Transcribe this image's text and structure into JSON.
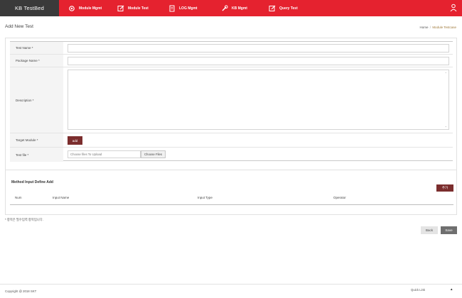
{
  "app": {
    "brand": "KB TestBed",
    "nav": [
      {
        "label": "Module Mgmt",
        "icon": "gear-icon"
      },
      {
        "label": "Module Test",
        "icon": "edit-icon"
      },
      {
        "label": "LOG Mgmt",
        "icon": "document-icon"
      },
      {
        "label": "KB Mgmt",
        "icon": "wrench-icon"
      },
      {
        "label": "Query Test",
        "icon": "edit-icon"
      }
    ],
    "user_icon": "user-icon"
  },
  "page": {
    "title": "Add New Test",
    "breadcrumb": {
      "home": "Home",
      "separator": "/",
      "current": "Module Testcase"
    }
  },
  "form": {
    "test_name": {
      "label": "Test Name *",
      "value": ""
    },
    "package_name": {
      "label": "Package Name *",
      "value": ""
    },
    "description": {
      "label": "Description *",
      "value": ""
    },
    "target_module": {
      "label": "Target Module *",
      "button": "add"
    },
    "test_file": {
      "label": "Test file *",
      "placeholder": "Choose files To Upload",
      "button": "Choose Files"
    }
  },
  "method": {
    "title": "Method Input Define Add",
    "add_button": "추가",
    "columns": [
      "Num",
      "Input Name",
      "Input Type",
      "Operator"
    ]
  },
  "note": "* 항목은 필수입력 항목입니다.",
  "actions": {
    "back": "Back",
    "save": "Save"
  },
  "footer": {
    "copyright": "Copyright @ 2018 SKT",
    "quick_link": "Quick Link",
    "quick_link_icon": "▲"
  },
  "colors": {
    "nav_red": "#e5222f",
    "brand_dark": "#3a3a3a",
    "button_dark_red": "#7b2d2d",
    "save_gray": "#6f6f6f"
  }
}
